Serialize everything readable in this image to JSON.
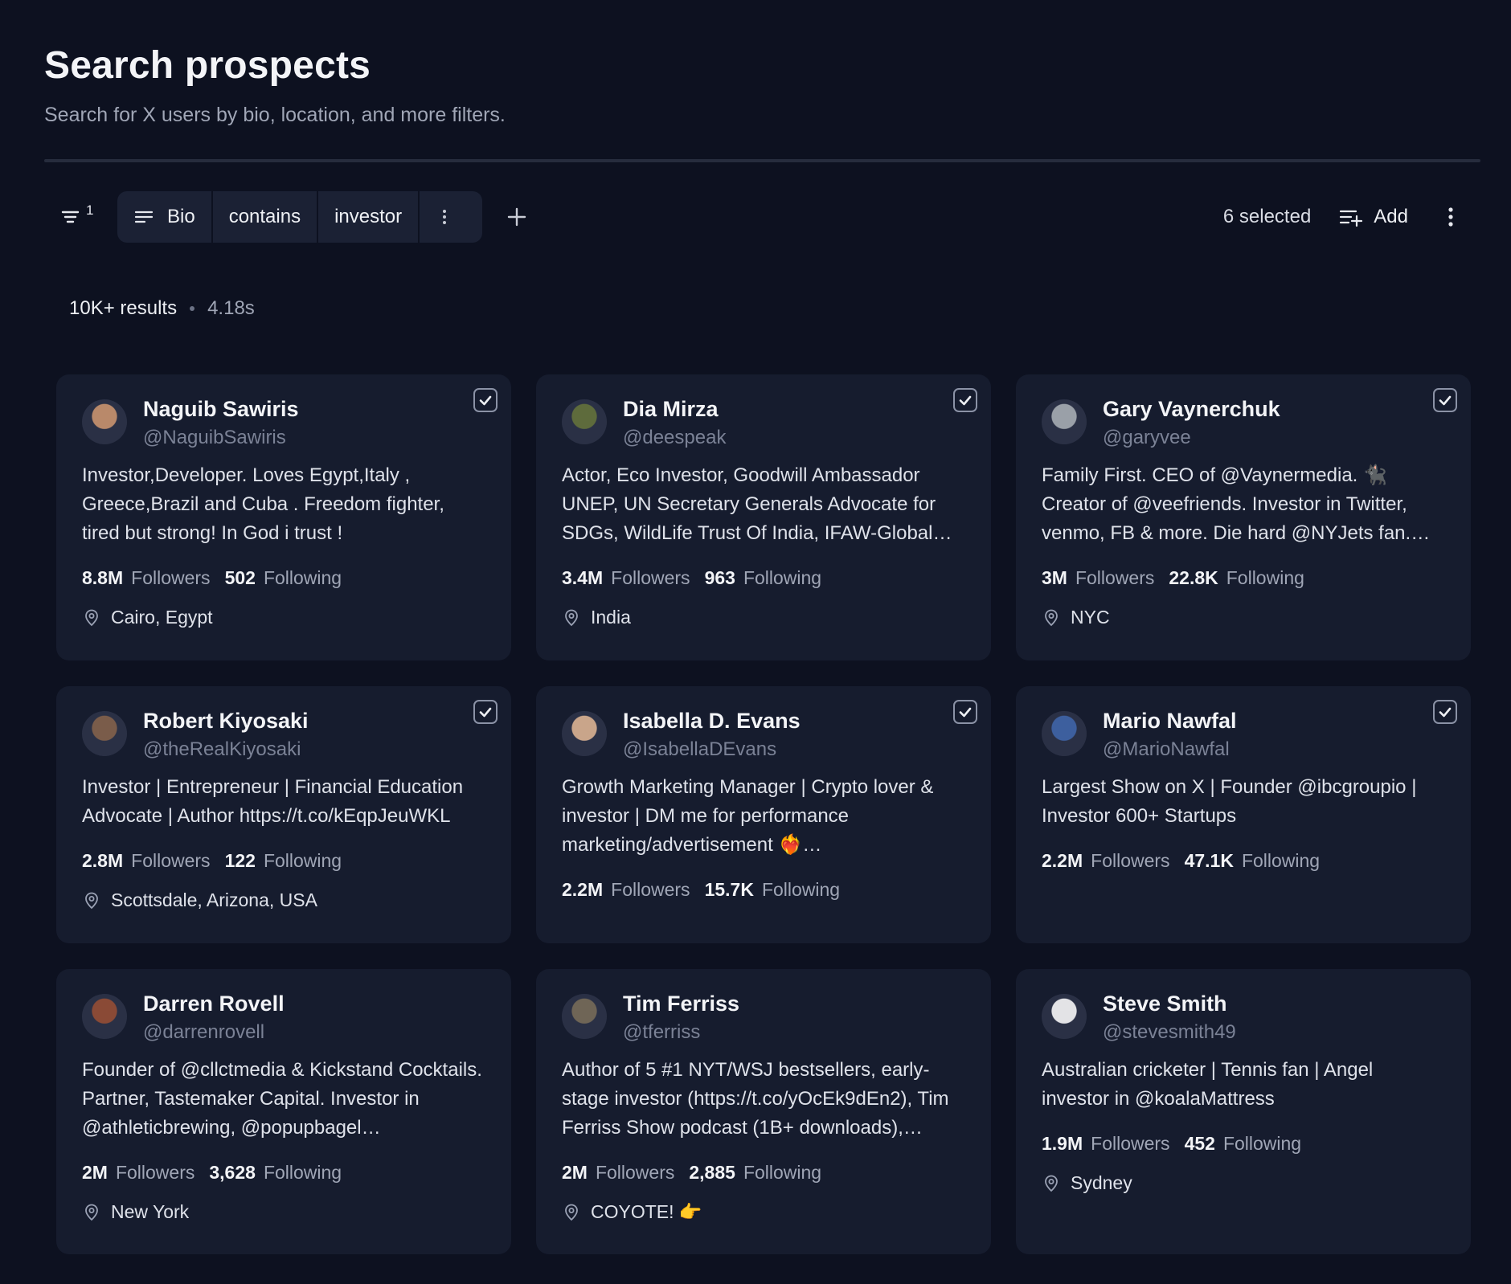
{
  "page": {
    "title": "Search prospects",
    "subtitle": "Search for X users by bio, location, and more filters."
  },
  "toolbar": {
    "filter_count": "1",
    "filter": {
      "field": "Bio",
      "operator": "contains",
      "value": "investor"
    },
    "selected": "6 selected",
    "add_label": "Add"
  },
  "results": {
    "count": "10K+ results",
    "time": "4.18s"
  },
  "colors": {
    "background": "#0d1120",
    "card": "#161c2e",
    "muted": "#7b8296"
  },
  "cards": [
    {
      "name": "Naguib Sawiris",
      "handle": "@NaguibSawiris",
      "bio": "Investor,Developer. Loves Egypt,Italy , Greece,Brazil and Cuba . Freedom fighter, tired but strong! In God i trust !",
      "followers": "8.8M",
      "followers_label": "Followers",
      "following": "502",
      "following_label": "Following",
      "location": "Cairo, Egypt",
      "checked": true,
      "avatar_color": "#b9896a"
    },
    {
      "name": "Dia Mirza",
      "handle": "@deespeak",
      "bio": "Actor, Eco Investor, Goodwill Ambassador UNEP, UN Secretary Generals Advocate for SDGs, WildLife Trust Of India, IFAW-Global…",
      "followers": "3.4M",
      "followers_label": "Followers",
      "following": "963",
      "following_label": "Following",
      "location": "India",
      "checked": true,
      "avatar_color": "#5e6b3c"
    },
    {
      "name": "Gary Vaynerchuk",
      "handle": "@garyvee",
      "bio": "Family First. CEO of @Vaynermedia. 🐈‍⬛ Creator of @veefriends. Investor in Twitter, venmo, FB & more. Die hard @NYJets fan.…",
      "followers": "3M",
      "followers_label": "Followers",
      "following": "22.8K",
      "following_label": "Following",
      "location": "NYC",
      "checked": true,
      "avatar_color": "#9aa0a8"
    },
    {
      "name": "Robert Kiyosaki",
      "handle": "@theRealKiyosaki",
      "bio": "Investor | Entrepreneur | Financial Education Advocate | Author https://t.co/kEqpJeuWKL",
      "followers": "2.8M",
      "followers_label": "Followers",
      "following": "122",
      "following_label": "Following",
      "location": "Scottsdale, Arizona, USA",
      "checked": true,
      "avatar_color": "#7a5c4a"
    },
    {
      "name": "Isabella D. Evans",
      "handle": "@IsabellaDEvans",
      "bio": "Growth Marketing Manager | Crypto lover & investor | DM me for performance marketing/advertisement ❤️‍🔥…",
      "followers": "2.2M",
      "followers_label": "Followers",
      "following": "15.7K",
      "following_label": "Following",
      "location": "",
      "checked": true,
      "avatar_color": "#c9a58a"
    },
    {
      "name": "Mario Nawfal",
      "handle": "@MarioNawfal",
      "bio": "Largest Show on X | Founder @ibcgroupio | Investor 600+ Startups",
      "followers": "2.2M",
      "followers_label": "Followers",
      "following": "47.1K",
      "following_label": "Following",
      "location": "",
      "checked": true,
      "avatar_color": "#3d5f9e"
    },
    {
      "name": "Darren Rovell",
      "handle": "@darrenrovell",
      "bio": "Founder of @cllctmedia & Kickstand Cocktails. Partner, Tastemaker Capital. Investor in @athleticbrewing, @popupbagel…",
      "followers": "2M",
      "followers_label": "Followers",
      "following": "3,628",
      "following_label": "Following",
      "location": "New York",
      "checked": false,
      "avatar_color": "#8a4a36"
    },
    {
      "name": "Tim Ferriss",
      "handle": "@tferriss",
      "bio": "Author of 5 #1 NYT/WSJ bestsellers, early-stage investor (https://t.co/yOcEk9dEn2), Tim Ferriss Show podcast (1B+ downloads),…",
      "followers": "2M",
      "followers_label": "Followers",
      "following": "2,885",
      "following_label": "Following",
      "location": "COYOTE! 👉",
      "checked": false,
      "avatar_color": "#6f6556"
    },
    {
      "name": "Steve Smith",
      "handle": "@stevesmith49",
      "bio": "Australian cricketer | Tennis fan | Angel investor in @koalaMattress",
      "followers": "1.9M",
      "followers_label": "Followers",
      "following": "452",
      "following_label": "Following",
      "location": "Sydney",
      "checked": false,
      "avatar_color": "#e3e3e6"
    }
  ]
}
